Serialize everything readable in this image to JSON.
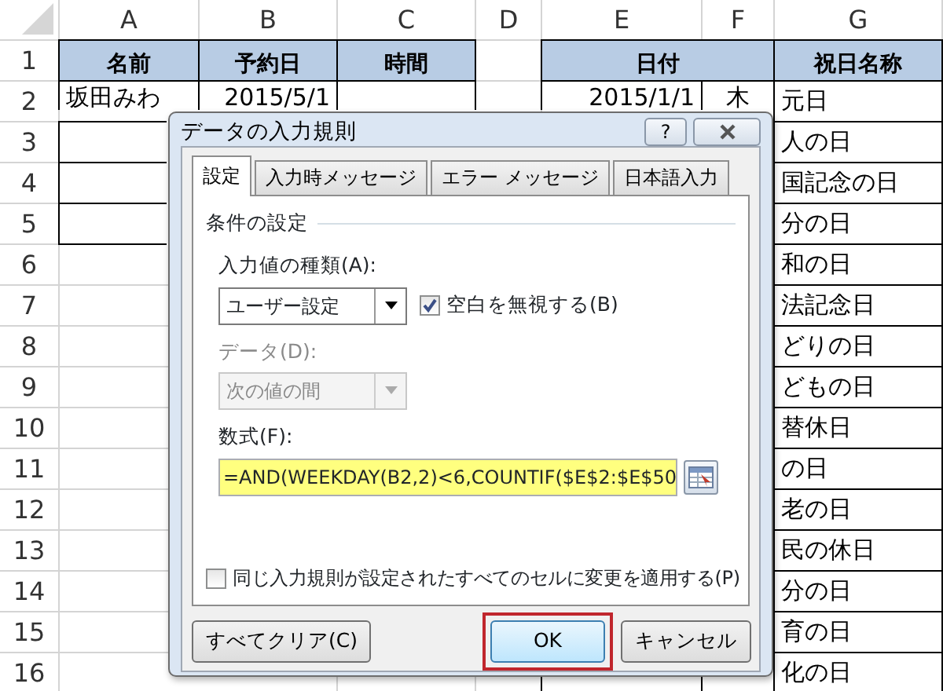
{
  "spreadsheet": {
    "column_headers": [
      "A",
      "B",
      "C",
      "D",
      "E",
      "F",
      "G"
    ],
    "rows": [
      {
        "number": "1",
        "kind": "header",
        "cells": [
          "名前",
          "予約日",
          "時間",
          "",
          "日付",
          "",
          "祝日名称"
        ]
      },
      {
        "number": "2",
        "kind": "data",
        "cells": [
          "坂田みわ",
          "2015/5/1",
          "",
          "",
          "2015/1/1",
          "木",
          "元日"
        ]
      },
      {
        "number": "3",
        "kind": "data",
        "cells": [
          "",
          "",
          "",
          "",
          "",
          "",
          "人の日"
        ]
      },
      {
        "number": "4",
        "kind": "data",
        "cells": [
          "",
          "",
          "",
          "",
          "",
          "",
          "国記念の日"
        ]
      },
      {
        "number": "5",
        "kind": "data",
        "cells": [
          "",
          "",
          "",
          "",
          "",
          "",
          "分の日"
        ]
      },
      {
        "number": "6",
        "kind": "data",
        "cells": [
          "",
          "",
          "",
          "",
          "",
          "",
          "和の日"
        ]
      },
      {
        "number": "7",
        "kind": "data",
        "cells": [
          "",
          "",
          "",
          "",
          "",
          "",
          "法記念日"
        ]
      },
      {
        "number": "8",
        "kind": "data",
        "cells": [
          "",
          "",
          "",
          "",
          "",
          "",
          "どりの日"
        ]
      },
      {
        "number": "9",
        "kind": "data",
        "cells": [
          "",
          "",
          "",
          "",
          "",
          "",
          "どもの日"
        ]
      },
      {
        "number": "10",
        "kind": "data",
        "cells": [
          "",
          "",
          "",
          "",
          "",
          "",
          "替休日"
        ]
      },
      {
        "number": "11",
        "kind": "data",
        "cells": [
          "",
          "",
          "",
          "",
          "",
          "",
          "の日"
        ]
      },
      {
        "number": "12",
        "kind": "data",
        "cells": [
          "",
          "",
          "",
          "",
          "",
          "",
          "老の日"
        ]
      },
      {
        "number": "13",
        "kind": "data",
        "cells": [
          "",
          "",
          "",
          "",
          "",
          "",
          "民の休日"
        ]
      },
      {
        "number": "14",
        "kind": "data",
        "cells": [
          "",
          "",
          "",
          "",
          "",
          "",
          "分の日"
        ]
      },
      {
        "number": "15",
        "kind": "data",
        "cells": [
          "",
          "",
          "",
          "",
          "",
          "",
          "育の日"
        ]
      },
      {
        "number": "16",
        "kind": "data",
        "cells": [
          "",
          "",
          "",
          "",
          "",
          "",
          "化の日"
        ]
      }
    ]
  },
  "dialog": {
    "title": "データの入力規則",
    "help_button": "?",
    "tabs": [
      {
        "label": "設定",
        "selected": true
      },
      {
        "label": "入力時メッセージ",
        "selected": false
      },
      {
        "label": "エラー メッセージ",
        "selected": false
      },
      {
        "label": "日本語入力",
        "selected": false
      }
    ],
    "section_title": "条件の設定",
    "allow": {
      "label": "入力値の種類(A):",
      "value": "ユーザー設定",
      "disabled": false
    },
    "ignore_blank": {
      "label": "空白を無視する(B)",
      "checked": true
    },
    "data": {
      "label": "データ(D):",
      "value": "次の値の間",
      "disabled": true
    },
    "formula": {
      "label": "数式(F):",
      "value": "=AND(WEEKDAY(B2,2)<6,COUNTIF($E$2:$E$50"
    },
    "apply_all": {
      "label": "同じ入力規則が設定されたすべてのセルに変更を適用する(P)",
      "checked": false
    },
    "buttons": [
      {
        "label": "すべてクリア(C)",
        "kind": "clear",
        "highlighted": false
      },
      {
        "label": "OK",
        "kind": "default",
        "highlighted": true
      },
      {
        "label": "キャンセル",
        "kind": "cancel",
        "highlighted": false
      }
    ]
  }
}
